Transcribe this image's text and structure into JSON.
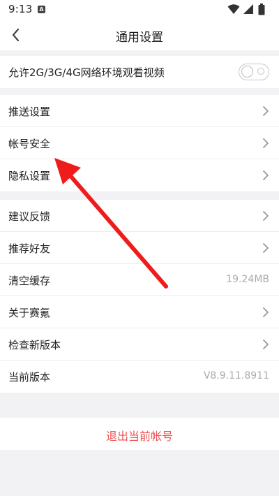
{
  "status_bar": {
    "time": "9:13",
    "icons": [
      "notification-a-icon",
      "wifi-icon",
      "signal-icon",
      "battery-icon"
    ]
  },
  "header": {
    "title": "通用设置",
    "back_icon": "chevron-left-icon"
  },
  "video_group": {
    "label": "允许2G/3G/4G网络环境观看视频",
    "toggle_on": false
  },
  "settings_group": {
    "items": [
      {
        "label": "推送设置"
      },
      {
        "label": "帐号安全"
      },
      {
        "label": "隐私设置"
      }
    ]
  },
  "misc_group": {
    "items": [
      {
        "label": "建议反馈"
      },
      {
        "label": "推荐好友"
      },
      {
        "label": "清空缓存",
        "value": "19.24MB"
      },
      {
        "label": "关于赛氪"
      },
      {
        "label": "检查新版本"
      },
      {
        "label": "当前版本",
        "value": "V8.9.11.8911"
      }
    ]
  },
  "logout": {
    "label": "退出当前帐号"
  },
  "colors": {
    "background": "#f2f2f4",
    "logout_text": "#ee5555",
    "annotation_arrow": "#ee1c1c"
  }
}
